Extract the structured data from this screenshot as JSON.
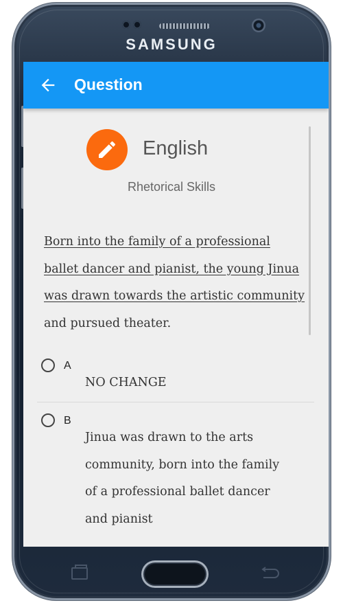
{
  "device": {
    "brand": "SAMSUNG"
  },
  "app_bar": {
    "title": "Question",
    "back_icon": "arrow-left-icon",
    "color": "#1497f5"
  },
  "subject": {
    "icon": "pencil-icon",
    "icon_color": "#fb6a0e",
    "title": "English",
    "subtitle": "Rhetorical Skills"
  },
  "passage": {
    "underlined": "Born into the family of a professional ballet dancer and pianist, the young Jinua was drawn towards the artistic community",
    "rest": " and pursued theater."
  },
  "options": [
    {
      "letter": "A",
      "text": "NO CHANGE",
      "selected": false
    },
    {
      "letter": "B",
      "text": "Jinua was drawn to the arts community, born into the family of a professional ballet dancer and pianist",
      "selected": false
    }
  ],
  "nav_keys": [
    "recent-apps-icon",
    "home-button",
    "back-key-icon"
  ]
}
